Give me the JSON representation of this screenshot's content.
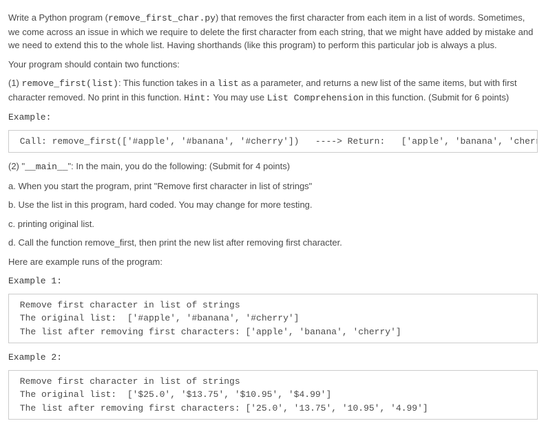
{
  "intro": {
    "p1_a": "Write a Python program (",
    "p1_code": "remove_first_char.py",
    "p1_b": ") that removes the first character from each item in a list of words. Sometimes, we come across an issue in which we require to delete the first character from each string, that we might have added by mistake and we need to extend this to the whole list. Having shorthands (like this program) to perform this particular job is always a plus.",
    "p2": "Your program should contain two functions:"
  },
  "func1": {
    "label": "(1) ",
    "code_sig": "remove_first(list)",
    "desc_a": ": This function takes in a ",
    "code_list": "list",
    "desc_b": " as a parameter, and returns a new list of the same items, but with first character removed. No print in this function. ",
    "hint_label": "Hint:",
    "hint_a": " You may use ",
    "code_lc": "List Comprehension",
    "hint_b": " in this function. (Submit for 6 points)"
  },
  "example_label": "Example:",
  "code1": " Call: remove_first(['#apple', '#banana', '#cherry'])   ----> Return:   ['apple', 'banana', 'cherry']",
  "main": {
    "label": "(2) \"",
    "code_main": "__main__",
    "desc": "\": In the main, you do the following: (Submit for 4 points)",
    "a": "a. When you start the program, print \"Remove first character in list of strings\"",
    "b": "b. Use the list in this program, hard coded. You may change for more testing.",
    "c": "c. printing original list.",
    "d": "d. Call the function remove_first, then print the new list after removing first character."
  },
  "runs_label": "Here are example runs of the program:",
  "ex1_label": "Example 1:",
  "code2": " Remove first character in list of strings\n The original list:  ['#apple', '#banana', '#cherry']\n The list after removing first characters: ['apple', 'banana', 'cherry']",
  "ex2_label": "Example 2:",
  "code3": " Remove first character in list of strings\n The original list:  ['$25.0', '$13.75', '$10.95', '$4.99']\n The list after removing first characters: ['25.0', '13.75', '10.95', '4.99']"
}
